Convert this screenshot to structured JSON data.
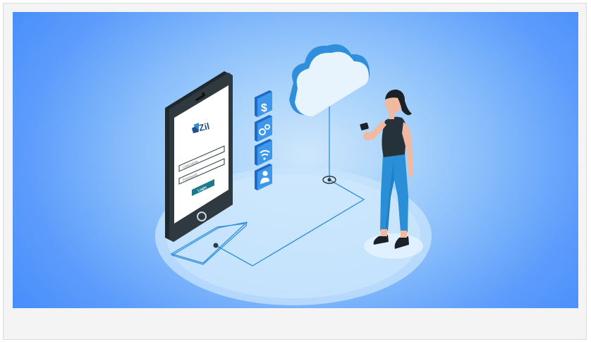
{
  "illustration": {
    "phone": {
      "brand": "Zil",
      "field_username": "Username",
      "field_password": "Password",
      "login_button": "Login"
    },
    "side_icons": [
      "dollar-icon",
      "gears-icon",
      "wifi-icon",
      "user-icon"
    ],
    "colors": {
      "background_outer": "#4a8ffb",
      "background_inner": "#cfe7fb",
      "phone_body": "#2f3a40",
      "accent_blue": "#2f8fdc",
      "teal_button": "#1d7a8a",
      "cloud": "#e8f4fd",
      "jeans": "#2a8fd6"
    }
  }
}
